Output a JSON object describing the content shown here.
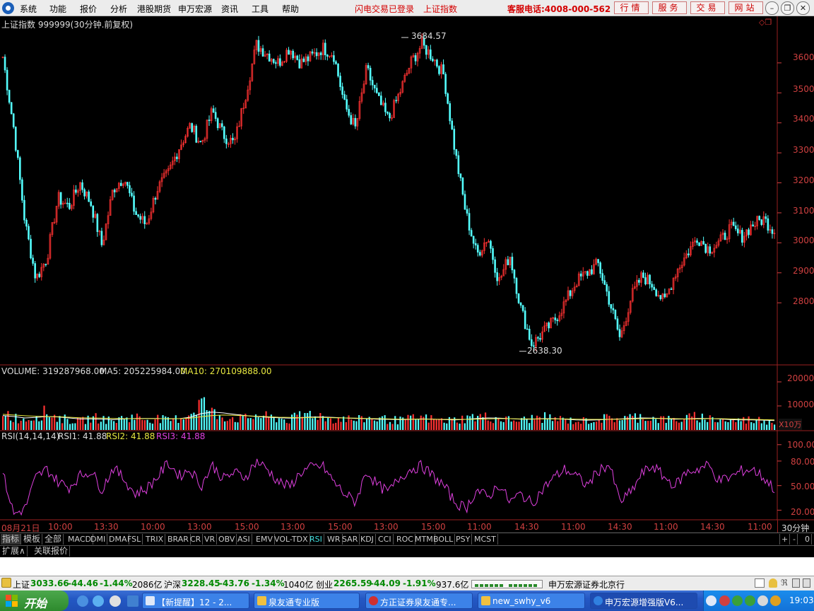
{
  "menu": {
    "items": [
      "系统",
      "功能",
      "报价",
      "分析",
      "港股期货",
      "申万宏源",
      "资讯",
      "工具",
      "帮助"
    ],
    "status1": "闪电交易已登录",
    "status2": "上证指数",
    "phone": "客服电话:4008-000-562",
    "tabs": [
      "行情",
      "服务",
      "交易",
      "网站"
    ]
  },
  "price_panel": {
    "title": "上证指数 999999(30分钟.前复权)",
    "high_label": "3684.57",
    "low_label": "2638.30",
    "y_ticks": [
      "3600",
      "3500",
      "3400",
      "3300",
      "3200",
      "3100",
      "3000",
      "2900",
      "2800"
    ]
  },
  "volume_panel": {
    "label": "VOLUME: 319287968.00",
    "ma5": "MA5: 205225984.00",
    "ma10": "MA10: 270109888.00",
    "y_ticks": [
      "20000",
      "10000"
    ],
    "unit": "X10万"
  },
  "rsi_panel": {
    "label": "RSI(14,14,14)",
    "rsi1": "RSI1: 41.88",
    "rsi2": "RSI2: 41.88",
    "rsi3": "RSI3: 41.88",
    "y_ticks": [
      "100.00",
      "80.00",
      "50.00",
      "20.00"
    ]
  },
  "time_axis": [
    "08月21日",
    "10:00",
    "13:30",
    "10:00",
    "13:00",
    "15:00",
    "13:00",
    "15:00",
    "13:00",
    "15:00",
    "11:00",
    "14:30",
    "11:00",
    "14:30",
    "11:00",
    "14:30",
    "11:00"
  ],
  "period": "30分钟",
  "indicator_tabs": [
    "指标",
    "模板",
    "全部",
    "MACD",
    "DMI",
    "DMA",
    "FSL",
    "TRIX",
    "BRAR",
    "CR",
    "VR",
    "OBV",
    "ASI",
    "EMV",
    "VOL-TDX",
    "RSI",
    "WR",
    "SAR",
    "KDJ",
    "CCI",
    "ROC",
    "MTM",
    "BOLL",
    "PSY",
    "MCST"
  ],
  "indicator_active": "RSI",
  "tab_controls": [
    "+",
    "-",
    "0"
  ],
  "sub_tabs": [
    "扩展∧",
    "关联报价"
  ],
  "ticker": {
    "sh_name": "上证",
    "sh_val": "3033.66",
    "sh_chg": "-44.46",
    "sh_pct": "-1.44%",
    "sh_amt": "2086亿",
    "hs_name": "沪深",
    "hs_val": "3228.45",
    "hs_chg": "-43.76",
    "hs_pct": "-1.34%",
    "hs_amt": "1040亿",
    "cy_name": "创业",
    "cy_val": "2265.59",
    "cy_chg": "-44.09",
    "cy_pct": "-1.91%",
    "cy_amt": "937.6亿",
    "broker": "申万宏源证券北京行"
  },
  "taskbar": {
    "start": "开始",
    "tasks": [
      "【新提醒】12 - 2...",
      "泉友通专业版",
      "方正证券泉友通专...",
      "new_swhy_v6",
      "申万宏源增强版V6..."
    ],
    "clock": "19:03"
  },
  "chart_data": [
    {
      "type": "candlestick",
      "title": "上证指数 999999(30分钟.前复权)",
      "ylim": [
        2600,
        3720
      ],
      "annotations": [
        {
          "label": "3684.57",
          "value": 3684.57
        },
        {
          "label": "2638.30",
          "value": 2638.3
        }
      ],
      "close_path": [
        3620,
        3380,
        3070,
        2880,
        2950,
        3150,
        3120,
        3200,
        3130,
        2990,
        3180,
        3220,
        3100,
        3060,
        3180,
        3230,
        3320,
        3390,
        3330,
        3440,
        3360,
        3330,
        3490,
        3660,
        3630,
        3600,
        3650,
        3600,
        3620,
        3650,
        3630,
        3460,
        3380,
        3580,
        3480,
        3410,
        3500,
        3600,
        3660,
        3620,
        3560,
        3310,
        3100,
        2960,
        3020,
        2870,
        2960,
        2780,
        2660,
        2700,
        2740,
        2800,
        2870,
        2900,
        2930,
        2810,
        2680,
        2820,
        2890,
        2860,
        2800,
        2900,
        2960,
        3020,
        2980,
        3000,
        3050,
        3020,
        3060,
        3080,
        3040
      ]
    },
    {
      "type": "bar",
      "title": "VOLUME",
      "series": [
        {
          "name": "VOLUME",
          "values": [
            8000,
            5200,
            4300,
            6100,
            7400,
            5000,
            4200,
            3600,
            5000,
            4800,
            3600,
            5200,
            5400,
            4500,
            4800,
            3800,
            4900,
            6800,
            12000,
            7000,
            5800,
            4900,
            4700,
            6100,
            5300,
            4800,
            4100,
            6000,
            7200,
            5600,
            4400,
            5000,
            4000,
            4900,
            4700,
            4300,
            3900,
            4600,
            5100,
            4400,
            3800,
            4200,
            4800,
            5600,
            5200,
            4700,
            4100,
            3900,
            4800,
            5200,
            4600,
            4200,
            3600,
            3900,
            4600,
            4800,
            4900,
            5100,
            5700,
            4800,
            4400,
            4000,
            4700,
            5500,
            4900,
            4200,
            3800,
            4100,
            4300,
            4000,
            3700
          ]
        },
        {
          "name": "MA5",
          "values": [
            6000,
            5600,
            5000,
            5200,
            5600,
            5400,
            5000,
            4600,
            4600,
            4500,
            4300,
            4600,
            4800,
            4800,
            4800,
            4600,
            4700,
            5300,
            6800,
            7400,
            7100,
            6500,
            6000,
            5600,
            5300,
            5100,
            4900,
            5100,
            5400,
            5400,
            5200,
            5000,
            4800,
            4700,
            4500,
            4400,
            4300,
            4400,
            4600,
            4500,
            4300,
            4200,
            4400,
            4800,
            5000,
            4900,
            4700,
            4500,
            4500,
            4700,
            4700,
            4500,
            4200,
            4100,
            4200,
            4400,
            4600,
            4800,
            5000,
            4900,
            4700,
            4500,
            4600,
            4800,
            4800,
            4600,
            4300,
            4200,
            4200,
            4100,
            3900
          ]
        },
        {
          "name": "MA10",
          "values": [
            6500,
            6200,
            5900,
            5700,
            5600,
            5500,
            5300,
            5100,
            5000,
            4900,
            4800,
            4700,
            4700,
            4700,
            4700,
            4700,
            4700,
            4900,
            5500,
            6000,
            6200,
            6100,
            5900,
            5700,
            5500,
            5300,
            5200,
            5100,
            5200,
            5200,
            5100,
            5000,
            4900,
            4800,
            4700,
            4600,
            4500,
            4500,
            4500,
            4500,
            4400,
            4400,
            4400,
            4500,
            4600,
            4700,
            4700,
            4600,
            4600,
            4600,
            4600,
            4600,
            4500,
            4400,
            4400,
            4400,
            4500,
            4600,
            4700,
            4800,
            4800,
            4700,
            4600,
            4600,
            4700,
            4700,
            4600,
            4500,
            4400,
            4300,
            4200
          ]
        }
      ],
      "ylim": [
        0,
        25000
      ]
    },
    {
      "type": "line",
      "title": "RSI(14,14,14)",
      "ylim": [
        10,
        105
      ],
      "series": [
        {
          "name": "RSI",
          "values": [
            65,
            15,
            22,
            60,
            70,
            55,
            48,
            62,
            68,
            45,
            72,
            58,
            40,
            46,
            60,
            78,
            62,
            70,
            50,
            75,
            58,
            66,
            60,
            80,
            70,
            55,
            48,
            66,
            72,
            74,
            55,
            40,
            30,
            68,
            50,
            42,
            60,
            70,
            74,
            62,
            50,
            30,
            22,
            45,
            35,
            52,
            30,
            40,
            28,
            46,
            60,
            70,
            62,
            50,
            68,
            76,
            30,
            42,
            65,
            74,
            60,
            50,
            66,
            70,
            75,
            56,
            60,
            68,
            70,
            60,
            46
          ]
        }
      ]
    }
  ]
}
